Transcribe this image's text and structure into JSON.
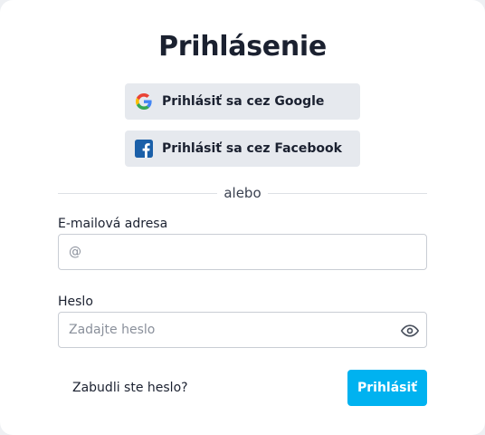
{
  "title": "Prihlásenie",
  "social": {
    "google_label": "Prihlásiť sa cez Google",
    "facebook_label": "Prihlásiť sa cez Facebook",
    "google_icon": "google-icon",
    "facebook_icon": "facebook-icon"
  },
  "divider_text": "alebo",
  "email": {
    "label": "E-mailová adresa",
    "placeholder": "@",
    "value": ""
  },
  "password": {
    "label": "Heslo",
    "placeholder": "Zadajte heslo",
    "value": "",
    "toggle_icon": "eye-icon"
  },
  "forgot_label": "Zabudli ste heslo?",
  "submit_label": "Prihlásiť",
  "colors": {
    "accent": "#00b2f0",
    "social_bg": "#e6e9ee",
    "text": "#1b2130",
    "facebook": "#1a5fa8"
  }
}
